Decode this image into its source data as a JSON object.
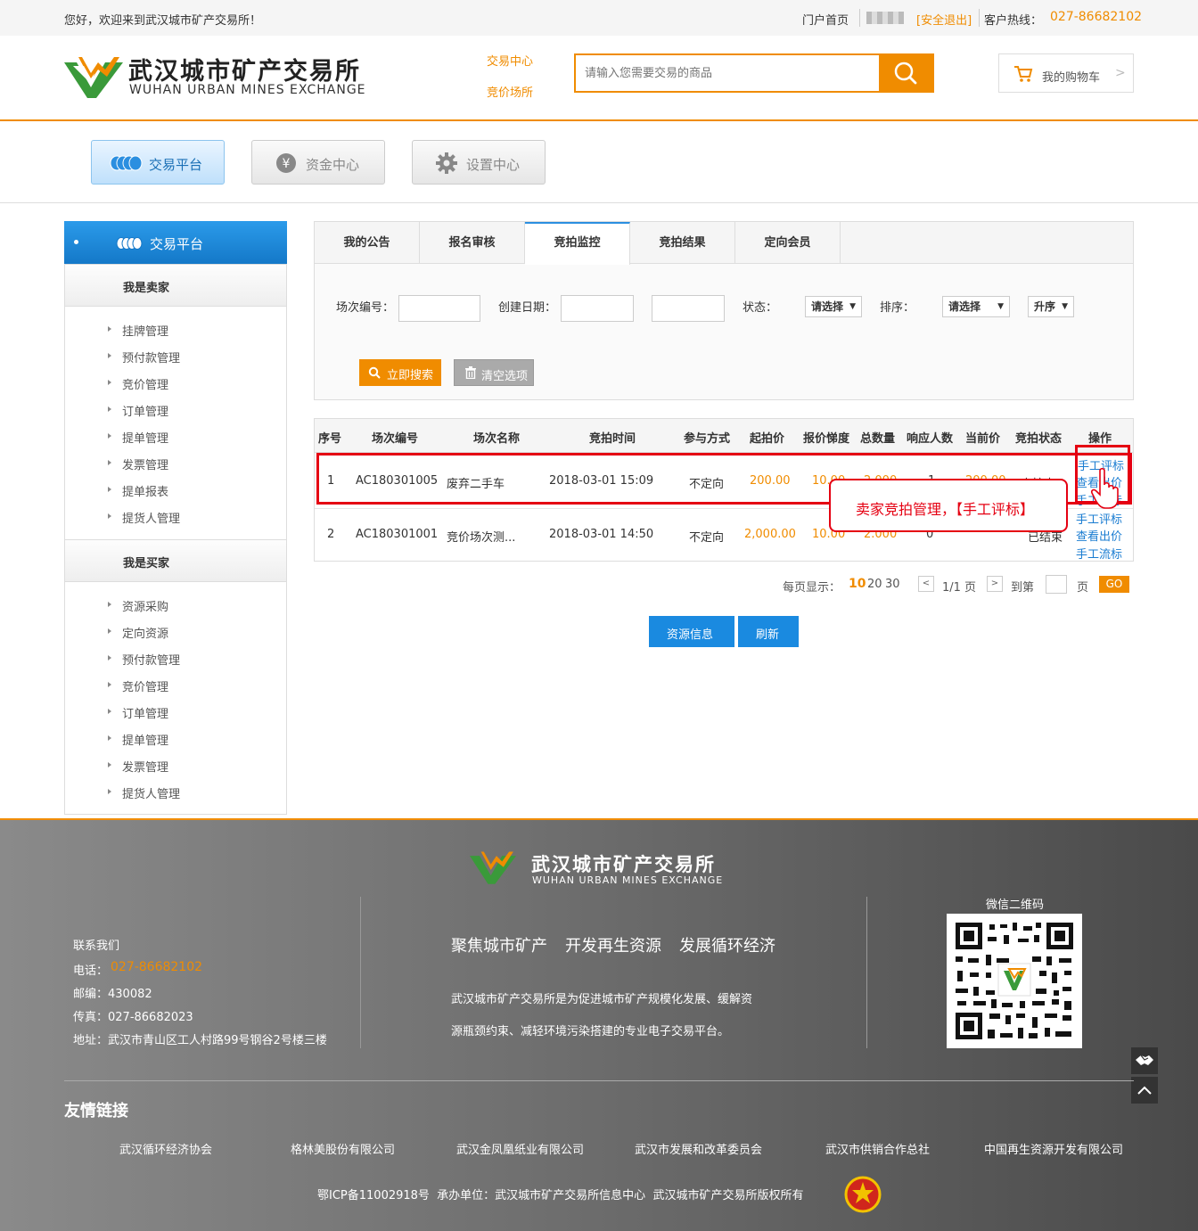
{
  "topbar": {
    "greeting": "您好，欢迎来到武汉城市矿产交易所！",
    "portal_home": "门户首页",
    "logout": "[安全退出]",
    "hotline_label": "客户热线：",
    "hotline": "027-86682102"
  },
  "brand": {
    "name_cn": "武汉城市矿产交易所",
    "name_en": "WUHAN URBAN MINES EXCHANGE",
    "color_orange": "#f08c00",
    "color_green": "#3a9a3a",
    "color_blue": "#1a8ae0"
  },
  "header": {
    "nav_trade": "交易中心",
    "nav_bid": "竞价场所",
    "search_placeholder": "请输入您需要交易的商品",
    "search_icon": "search-icon",
    "cart_label": "我的购物车",
    "cart_arrow": ">"
  },
  "main_tabs": [
    {
      "label": "交易平台",
      "icon": "coins-icon",
      "active": true
    },
    {
      "label": "资金中心",
      "icon": "yen-icon",
      "active": false
    },
    {
      "label": "设置中心",
      "icon": "gear-icon",
      "active": false
    }
  ],
  "sidebar": {
    "title": "交易平台",
    "seller_title": "我是卖家",
    "seller_items": [
      "挂牌管理",
      "预付款管理",
      "竞价管理",
      "订单管理",
      "提单管理",
      "发票管理",
      "提单报表",
      "提货人管理"
    ],
    "buyer_title": "我是买家",
    "buyer_items": [
      "资源采购",
      "定向资源",
      "预付款管理",
      "竞价管理",
      "订单管理",
      "提单管理",
      "发票管理",
      "提货人管理"
    ]
  },
  "sub_tabs": [
    {
      "label": "我的公告",
      "active": false
    },
    {
      "label": "报名审核",
      "active": false
    },
    {
      "label": "竞拍监控",
      "active": true
    },
    {
      "label": "竞拍结果",
      "active": false
    },
    {
      "label": "定向会员",
      "active": false
    }
  ],
  "filters": {
    "session_no_label": "场次编号：",
    "date_label": "创建日期：",
    "status_label": "状态：",
    "status_value": "请选择",
    "sort_label": "排序：",
    "sort_value": "请选择",
    "order_value": "升序",
    "caret": "▼",
    "search_btn": "立即搜索",
    "clear_btn": "清空选项"
  },
  "table": {
    "headers": [
      "序号",
      "场次编号",
      "场次名称",
      "竞拍时间",
      "参与方式",
      "起拍价",
      "报价悌度",
      "总数量",
      "响应人数",
      "当前价",
      "竞拍状态",
      "操作"
    ],
    "rows": [
      {
        "no": "1",
        "code": "AC180301005",
        "name": "废弃二手车",
        "time": "2018-03-01 15:09",
        "mode": "不定向",
        "start_price": "200.00",
        "step": "10.00",
        "qty": "2.000",
        "responders": "1",
        "current": "200.00",
        "status": "竞拍中",
        "ops": [
          "手工评标",
          "查看出价",
          "手工流标"
        ]
      },
      {
        "no": "2",
        "code": "AC180301001",
        "name": "竞价场次测...",
        "time": "2018-03-01 14:50",
        "mode": "不定向",
        "start_price": "2,000.00",
        "step": "10.00",
        "qty": "2.000",
        "responders": "0",
        "current": "",
        "status": "已结束",
        "ops": [
          "手工评标",
          "查看出价",
          "手工流标"
        ]
      }
    ]
  },
  "callout": "卖家竞拍管理，【手工评标】",
  "pagination": {
    "per_page_label": "每页显示：",
    "size_10": "10",
    "size_20": "20",
    "size_30": "30",
    "prev": "<",
    "page_info": "1/1 页",
    "next": ">",
    "goto_label": "到第",
    "page_unit": "页",
    "go": "GO"
  },
  "actions": {
    "resource_info": "资源信息",
    "refresh": "刷新"
  },
  "footer": {
    "contact_title": "联系我们",
    "phone_label": "电话：",
    "phone": "027-86682102",
    "zip": "邮编：430082",
    "fax": "传真：027-86682023",
    "address": "地址：武汉市青山区工人村路99号钢谷2号楼三楼",
    "slogan_1": "聚焦城市矿产",
    "slogan_2": "开发再生资源",
    "slogan_3": "发展循环经济",
    "desc_1": "武汉城市矿产交易所是为促进城市矿产规模化发展、缓解资",
    "desc_2": "源瓶颈约束、减轻环境污染搭建的专业电子交易平台。",
    "wechat_label": "微信二维码",
    "links_title": "友情链接",
    "links": [
      "武汉循环经济协会",
      "格林美股份有限公司",
      "武汉金凤凰纸业有限公司",
      "武汉市发展和改革委员会",
      "武汉市供销合作总社",
      "中国再生资源开发有限公司"
    ],
    "icp": "鄂ICP备11002918号  承办单位：武汉城市矿产交易所信息中心  武汉城市矿产交易所版权所有"
  }
}
